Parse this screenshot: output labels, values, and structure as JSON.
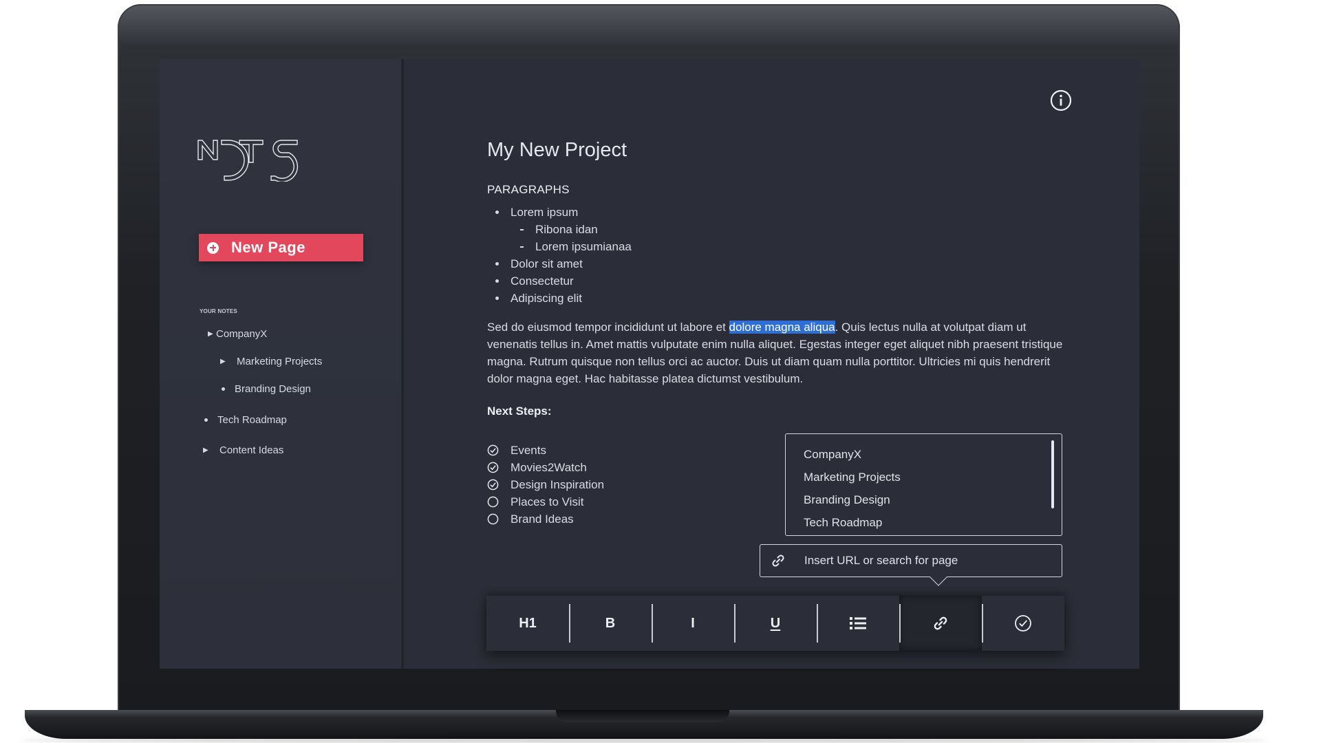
{
  "sidebar": {
    "logo_text": "NOTS",
    "new_page_label": "New Page",
    "notes_heading": "YOUR NOTES",
    "items": [
      {
        "label": "CompanyX",
        "marker": "▶"
      },
      {
        "label": "Marketing Projects",
        "marker": "▶"
      },
      {
        "label": "Branding Design",
        "marker": "dot"
      },
      {
        "label": "Tech Roadmap",
        "marker": "dot"
      },
      {
        "label": "Content Ideas",
        "marker": "▶"
      }
    ]
  },
  "document": {
    "title": "My New Project",
    "section_label": "PARAGRAPHS",
    "bullets": [
      {
        "text": "Lorem ipsum",
        "level": 1
      },
      {
        "text": "Ribona idan",
        "level": 2
      },
      {
        "text": "Lorem ipsumianaa",
        "level": 2
      },
      {
        "text": "Dolor sit amet",
        "level": 1
      },
      {
        "text": "Consectetur",
        "level": 1
      },
      {
        "text": "Adipiscing elit",
        "level": 1
      }
    ],
    "paragraph_before": "Sed do eiusmod tempor incididunt ut labore et ",
    "paragraph_highlight": "dolore magna aliqua",
    "paragraph_after": ". Quis lectus nulla at volutpat diam ut venenatis tellus in. Amet mattis vulputate enim nulla aliquet. Egestas integer eget aliquet nibh praesent tristique magna. Rutrum quisque non tellus orci ac auctor. Duis ut diam quam nulla porttitor. Ultricies mi quis hendrerit dolor magna eget. Hac habitasse platea dictumst vestibulum.",
    "next_steps_label": "Next Steps:",
    "checklist": [
      {
        "label": "Events",
        "checked": true
      },
      {
        "label": "Movies2Watch",
        "checked": true
      },
      {
        "label": "Design Inspiration",
        "checked": true
      },
      {
        "label": "Places to Visit",
        "checked": false
      },
      {
        "label": "Brand Ideas",
        "checked": false
      }
    ]
  },
  "link_popover": {
    "suggestions": [
      "CompanyX",
      "Marketing Projects",
      "Branding Design",
      "Tech Roadmap"
    ],
    "input_placeholder": "Insert URL or search for page",
    "input_value": ""
  },
  "toolbar": {
    "h1_label": "H1",
    "bold_label": "B",
    "italic_label": "I",
    "underline_label": "U",
    "active_tool": "link"
  },
  "colors": {
    "accent": "#e2475c",
    "highlight": "#2d6fd6",
    "background": "#2b2e38"
  },
  "icons": {
    "info": "info-icon",
    "list": "list-icon",
    "link": "link-icon",
    "check": "check-circle-icon",
    "plus": "plus-circle-icon"
  }
}
